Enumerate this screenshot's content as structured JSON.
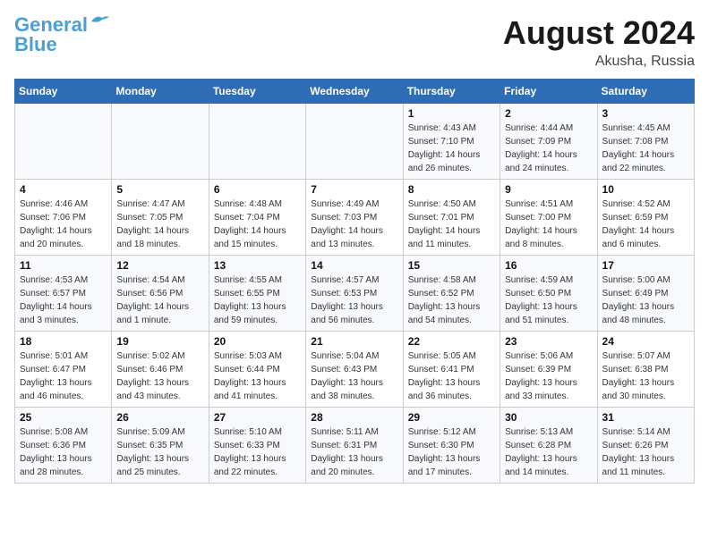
{
  "logo": {
    "line1": "General",
    "line2": "Blue"
  },
  "title": "August 2024",
  "subtitle": "Akusha, Russia",
  "days_of_week": [
    "Sunday",
    "Monday",
    "Tuesday",
    "Wednesday",
    "Thursday",
    "Friday",
    "Saturday"
  ],
  "weeks": [
    [
      {
        "day": "",
        "info": ""
      },
      {
        "day": "",
        "info": ""
      },
      {
        "day": "",
        "info": ""
      },
      {
        "day": "",
        "info": ""
      },
      {
        "day": "1",
        "info": "Sunrise: 4:43 AM\nSunset: 7:10 PM\nDaylight: 14 hours\nand 26 minutes."
      },
      {
        "day": "2",
        "info": "Sunrise: 4:44 AM\nSunset: 7:09 PM\nDaylight: 14 hours\nand 24 minutes."
      },
      {
        "day": "3",
        "info": "Sunrise: 4:45 AM\nSunset: 7:08 PM\nDaylight: 14 hours\nand 22 minutes."
      }
    ],
    [
      {
        "day": "4",
        "info": "Sunrise: 4:46 AM\nSunset: 7:06 PM\nDaylight: 14 hours\nand 20 minutes."
      },
      {
        "day": "5",
        "info": "Sunrise: 4:47 AM\nSunset: 7:05 PM\nDaylight: 14 hours\nand 18 minutes."
      },
      {
        "day": "6",
        "info": "Sunrise: 4:48 AM\nSunset: 7:04 PM\nDaylight: 14 hours\nand 15 minutes."
      },
      {
        "day": "7",
        "info": "Sunrise: 4:49 AM\nSunset: 7:03 PM\nDaylight: 14 hours\nand 13 minutes."
      },
      {
        "day": "8",
        "info": "Sunrise: 4:50 AM\nSunset: 7:01 PM\nDaylight: 14 hours\nand 11 minutes."
      },
      {
        "day": "9",
        "info": "Sunrise: 4:51 AM\nSunset: 7:00 PM\nDaylight: 14 hours\nand 8 minutes."
      },
      {
        "day": "10",
        "info": "Sunrise: 4:52 AM\nSunset: 6:59 PM\nDaylight: 14 hours\nand 6 minutes."
      }
    ],
    [
      {
        "day": "11",
        "info": "Sunrise: 4:53 AM\nSunset: 6:57 PM\nDaylight: 14 hours\nand 3 minutes."
      },
      {
        "day": "12",
        "info": "Sunrise: 4:54 AM\nSunset: 6:56 PM\nDaylight: 14 hours\nand 1 minute."
      },
      {
        "day": "13",
        "info": "Sunrise: 4:55 AM\nSunset: 6:55 PM\nDaylight: 13 hours\nand 59 minutes."
      },
      {
        "day": "14",
        "info": "Sunrise: 4:57 AM\nSunset: 6:53 PM\nDaylight: 13 hours\nand 56 minutes."
      },
      {
        "day": "15",
        "info": "Sunrise: 4:58 AM\nSunset: 6:52 PM\nDaylight: 13 hours\nand 54 minutes."
      },
      {
        "day": "16",
        "info": "Sunrise: 4:59 AM\nSunset: 6:50 PM\nDaylight: 13 hours\nand 51 minutes."
      },
      {
        "day": "17",
        "info": "Sunrise: 5:00 AM\nSunset: 6:49 PM\nDaylight: 13 hours\nand 48 minutes."
      }
    ],
    [
      {
        "day": "18",
        "info": "Sunrise: 5:01 AM\nSunset: 6:47 PM\nDaylight: 13 hours\nand 46 minutes."
      },
      {
        "day": "19",
        "info": "Sunrise: 5:02 AM\nSunset: 6:46 PM\nDaylight: 13 hours\nand 43 minutes."
      },
      {
        "day": "20",
        "info": "Sunrise: 5:03 AM\nSunset: 6:44 PM\nDaylight: 13 hours\nand 41 minutes."
      },
      {
        "day": "21",
        "info": "Sunrise: 5:04 AM\nSunset: 6:43 PM\nDaylight: 13 hours\nand 38 minutes."
      },
      {
        "day": "22",
        "info": "Sunrise: 5:05 AM\nSunset: 6:41 PM\nDaylight: 13 hours\nand 36 minutes."
      },
      {
        "day": "23",
        "info": "Sunrise: 5:06 AM\nSunset: 6:39 PM\nDaylight: 13 hours\nand 33 minutes."
      },
      {
        "day": "24",
        "info": "Sunrise: 5:07 AM\nSunset: 6:38 PM\nDaylight: 13 hours\nand 30 minutes."
      }
    ],
    [
      {
        "day": "25",
        "info": "Sunrise: 5:08 AM\nSunset: 6:36 PM\nDaylight: 13 hours\nand 28 minutes."
      },
      {
        "day": "26",
        "info": "Sunrise: 5:09 AM\nSunset: 6:35 PM\nDaylight: 13 hours\nand 25 minutes."
      },
      {
        "day": "27",
        "info": "Sunrise: 5:10 AM\nSunset: 6:33 PM\nDaylight: 13 hours\nand 22 minutes."
      },
      {
        "day": "28",
        "info": "Sunrise: 5:11 AM\nSunset: 6:31 PM\nDaylight: 13 hours\nand 20 minutes."
      },
      {
        "day": "29",
        "info": "Sunrise: 5:12 AM\nSunset: 6:30 PM\nDaylight: 13 hours\nand 17 minutes."
      },
      {
        "day": "30",
        "info": "Sunrise: 5:13 AM\nSunset: 6:28 PM\nDaylight: 13 hours\nand 14 minutes."
      },
      {
        "day": "31",
        "info": "Sunrise: 5:14 AM\nSunset: 6:26 PM\nDaylight: 13 hours\nand 11 minutes."
      }
    ]
  ]
}
